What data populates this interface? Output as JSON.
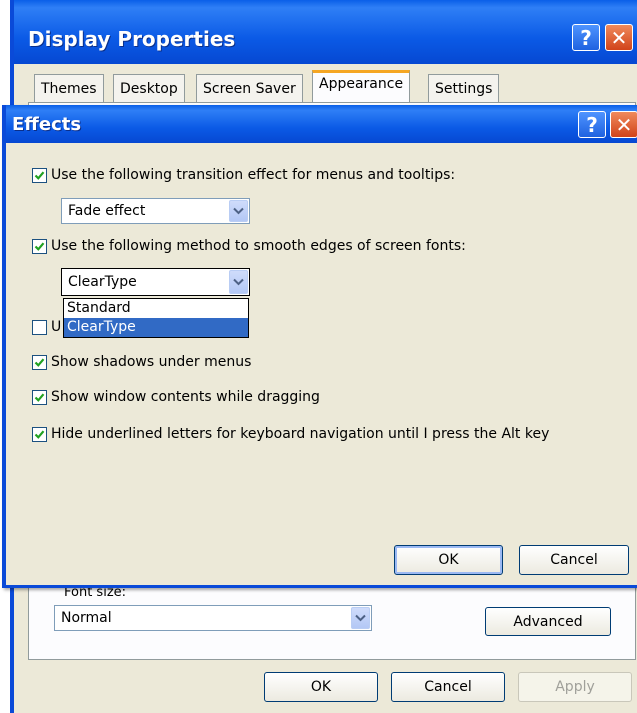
{
  "display_properties": {
    "title": "Display Properties",
    "help_glyph": "?",
    "close_glyph": "✕",
    "tabs": [
      {
        "label": "Themes"
      },
      {
        "label": "Desktop"
      },
      {
        "label": "Screen Saver"
      },
      {
        "label": "Appearance",
        "selected": true
      },
      {
        "label": "Settings"
      }
    ],
    "font_size_label": "Font size:",
    "font_size_value": "Normal",
    "advanced_label": "Advanced",
    "ok_label": "OK",
    "cancel_label": "Cancel",
    "apply_label": "Apply"
  },
  "effects": {
    "title": "Effects",
    "help_glyph": "?",
    "close_glyph": "✕",
    "options": [
      {
        "label": "Use the following transition effect for menus and tooltips:",
        "checked": true
      },
      {
        "label": "Use the following method to smooth edges of screen fonts:",
        "checked": true
      },
      {
        "label": "U",
        "checked": false
      },
      {
        "label": "Show shadows under menus",
        "checked": true
      },
      {
        "label": "Show window contents while dragging",
        "checked": true
      },
      {
        "label": "Hide underlined letters for keyboard navigation until I press the Alt key",
        "checked": true
      }
    ],
    "transition_value": "Fade effect",
    "smoothing_value": "ClearType",
    "smoothing_options": [
      "Standard",
      "ClearType"
    ],
    "smoothing_selected": "ClearType",
    "ok_label": "OK",
    "cancel_label": "Cancel"
  },
  "colors": {
    "title_blue": "#0b5ae6",
    "window_face": "#ECE9D8",
    "close_red": "#d1431a",
    "selection_blue": "#316ac5",
    "tab_highlight": "#f5a623"
  },
  "icons": [
    "help-icon",
    "close-icon",
    "checkmark-icon",
    "chevron-down-icon"
  ]
}
